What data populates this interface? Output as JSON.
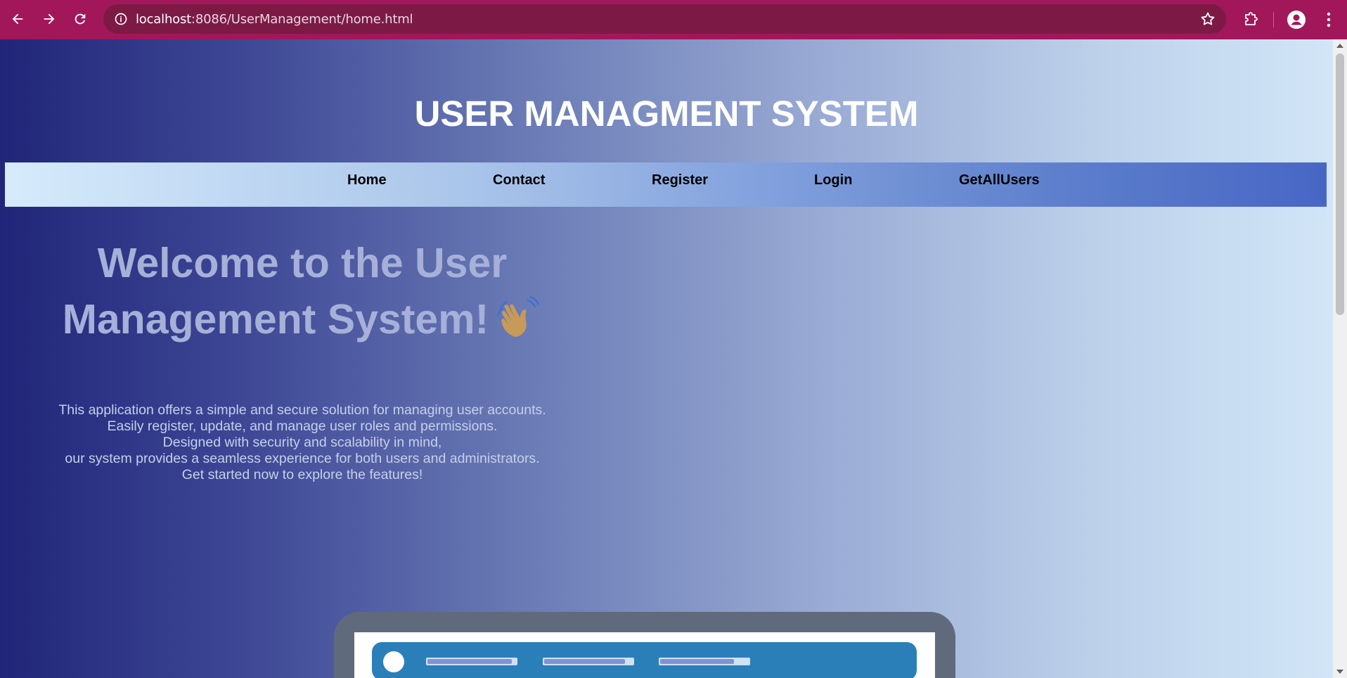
{
  "browser": {
    "url_host": "localhost",
    "url_rest": ":8086/UserManagement/home.html",
    "icons": [
      "back-arrow-icon",
      "forward-arrow-icon",
      "reload-icon",
      "site-info-icon",
      "bookmark-star-icon",
      "extensions-icon",
      "profile-icon",
      "more-menu-icon"
    ],
    "colors": {
      "frame": "#a2175a",
      "omnibox": "#7c1a45"
    }
  },
  "page": {
    "title": "USER MANAGMENT SYSTEM",
    "nav": [
      {
        "label": "Home"
      },
      {
        "label": "Contact"
      },
      {
        "label": "Register"
      },
      {
        "label": "Login"
      },
      {
        "label": "GetAllUsers"
      }
    ],
    "welcome_line1": "Welcome to the User",
    "welcome_line2": "Management System!",
    "welcome_emoji": "waving-hand-icon",
    "description": [
      "This application offers a simple and secure solution for managing user accounts.",
      "Easily register, update, and manage user roles and permissions.",
      "Designed with security and scalability in mind,",
      "our system provides a seamless experience for both users and administrators.",
      "Get started now to explore the features!"
    ],
    "colors": {
      "gradient_start": "#212579",
      "gradient_end": "#d2e6f8",
      "title_text": "#ffffff",
      "welcome_text": "#a6b0d8",
      "nav_text": "#000000"
    }
  }
}
